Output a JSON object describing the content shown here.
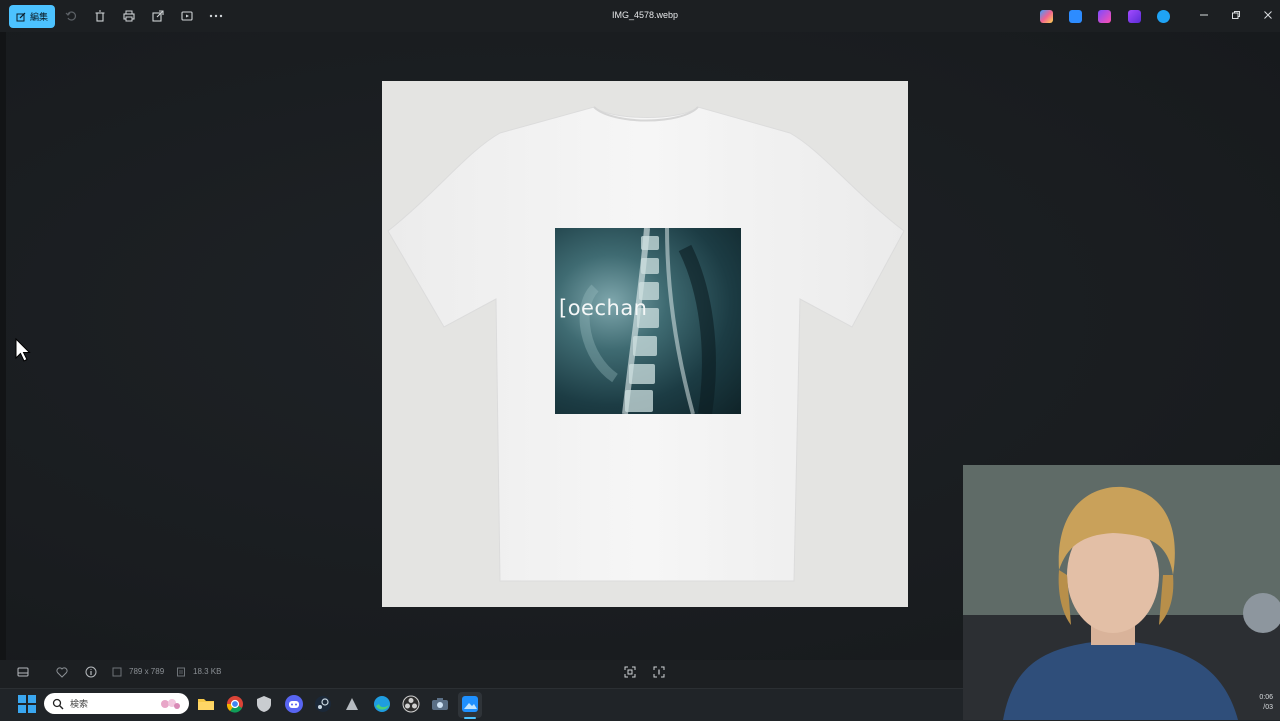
{
  "toolbar": {
    "edit_label": "編集",
    "icons": [
      "edit-icon",
      "rotate-icon",
      "delete-icon",
      "print-icon",
      "share-icon",
      "slideshow-icon",
      "more-icon"
    ],
    "file_name": "IMG_4578.webp",
    "app_icons": [
      "copilot-icon",
      "photos-icon",
      "clipchamp-icon",
      "designer-icon",
      "onedrive-icon"
    ]
  },
  "photo": {
    "print_text": "[oechan",
    "colors": {
      "shirt": "#f3f3f3",
      "backdrop": "#e4e4e2",
      "accent": "#4cc2ff"
    }
  },
  "infobar": {
    "dimensions": "789 x 789",
    "file_size": "18.3 KB"
  },
  "taskbar": {
    "search_placeholder": "検索",
    "apps": [
      "file-explorer-icon",
      "chrome-icon",
      "shield-icon",
      "discord-icon",
      "steam-icon",
      "app-icon",
      "edge-icon",
      "obs-icon",
      "camera-icon",
      "photos-icon"
    ],
    "clock_time": "0:06",
    "clock_date": "/03"
  }
}
